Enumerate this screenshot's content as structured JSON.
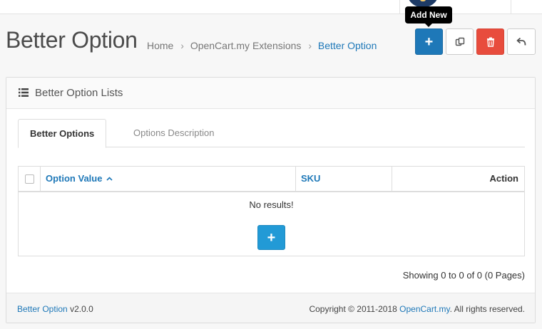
{
  "tooltip": "Add New",
  "header": {
    "title": "Better Option",
    "breadcrumb": [
      {
        "label": "Home"
      },
      {
        "label": "OpenCart.my Extensions"
      },
      {
        "label": "Better Option"
      }
    ],
    "separator": "›"
  },
  "toolbar": {
    "add_icon": "plus-icon",
    "copy_icon": "copy-icon",
    "delete_icon": "trash-icon",
    "back_icon": "reply-icon"
  },
  "panel": {
    "title": "Better Option Lists",
    "icon": "list-icon",
    "tabs": [
      {
        "label": "Better Options",
        "active": true
      },
      {
        "label": "Options Description",
        "active": false
      }
    ],
    "table": {
      "columns": {
        "option_value": "Option Value",
        "sku": "SKU",
        "action": "Action"
      },
      "empty_text": "No results!"
    },
    "pagination_text": "Showing 0 to 0 of 0 (0 Pages)"
  },
  "footer": {
    "product_link": "Better Option",
    "version": "v2.0.0",
    "copyright_prefix": "Copyright © 2011-2018",
    "company_link": "OpenCart.my",
    "copyright_suffix": ". All rights reserved."
  },
  "colors": {
    "primary": "#1e78b8",
    "danger": "#e84c3d",
    "info": "#229ad6"
  }
}
